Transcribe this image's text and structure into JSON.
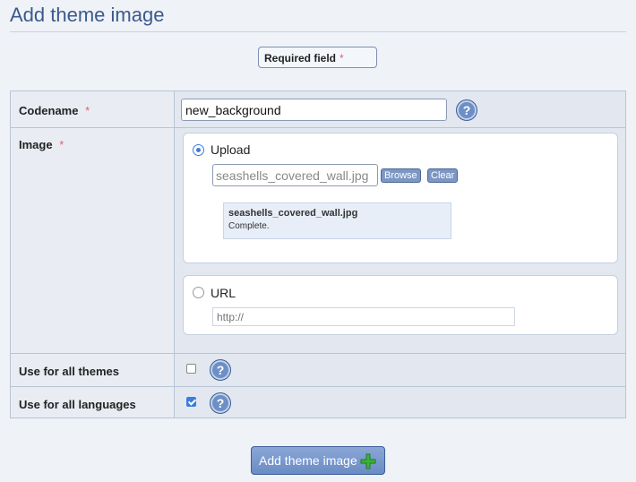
{
  "page": {
    "title": "Add theme image"
  },
  "required_note": {
    "label": "Required field",
    "star": "*"
  },
  "form": {
    "codename": {
      "label": "Codename",
      "star": "*",
      "value": "new_background"
    },
    "image": {
      "label": "Image",
      "star": "*",
      "upload": {
        "label": "Upload",
        "selected": true,
        "file_value": "seashells_covered_wall.jpg",
        "browse_label": "Browse",
        "clear_label": "Clear",
        "status_filename": "seashells_covered_wall.jpg",
        "status_text": "Complete."
      },
      "url": {
        "label": "URL",
        "selected": false,
        "placeholder": "http://"
      }
    },
    "all_themes": {
      "label": "Use for all themes",
      "checked": false
    },
    "all_languages": {
      "label": "Use for all languages",
      "checked": true
    },
    "help_glyph": "?"
  },
  "submit": {
    "label": "Add theme image"
  },
  "colors": {
    "accent": "#3b5a8c",
    "required": "#e06070",
    "check": "#3b7de0",
    "plus": "#3ab33a"
  }
}
